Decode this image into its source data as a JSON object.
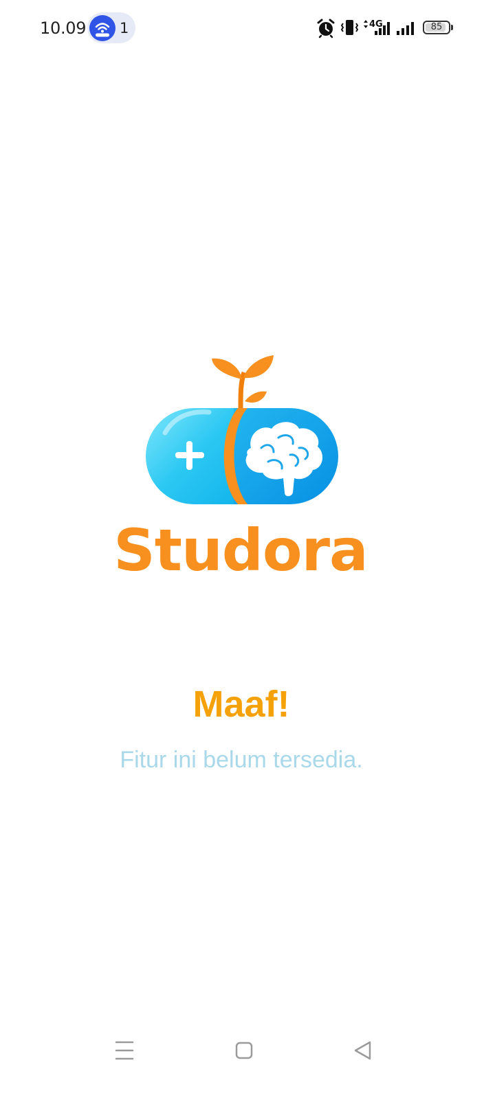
{
  "status_bar": {
    "time": "10.09",
    "hotspot_count": "1",
    "battery_level": "85",
    "network_type": "4G",
    "icons": [
      "hotspot-icon",
      "alarm-icon",
      "vibrate-icon",
      "mobile-data-icon",
      "signal-icon",
      "battery-icon"
    ]
  },
  "app": {
    "brand_name": "Studora",
    "logo_icon": "pill-brain-sprout-logo"
  },
  "message": {
    "title": "Maaf!",
    "subtitle": "Fitur ini belum tersedia."
  },
  "nav_bar": {
    "icons": [
      "menu-icon",
      "home-icon",
      "back-icon"
    ]
  },
  "colors": {
    "brand_orange": "#f7901e",
    "title_orange": "#f5a20a",
    "subtitle_blue": "#a9d8ea",
    "pill_blue_light": "#52d6f7",
    "pill_blue_dark": "#0a9be8",
    "hotspot_blue": "#2f54e6"
  }
}
